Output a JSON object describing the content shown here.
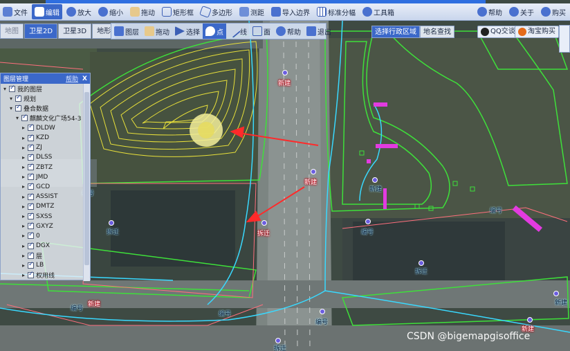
{
  "toolbar": {
    "file": "文件",
    "edit": "编辑",
    "zoom_in": "放大",
    "zoom_out": "缩小",
    "pan": "拖动",
    "rect": "矩形框",
    "polygon": "多边形",
    "measure": "测距",
    "import": "导入边界",
    "grid": "标准分幅",
    "toolbox": "工具箱",
    "help": "帮助",
    "about": "关于",
    "buy": "购买"
  },
  "view_tabs": {
    "map": "地图",
    "sat2d": "卫星2D",
    "sat3d": "卫星3D",
    "terrain": "地形"
  },
  "tools2": {
    "layers": "图层",
    "pan": "拖动",
    "select": "选择",
    "point": "点",
    "line": "线",
    "area": "面",
    "help": "帮助",
    "exit": "退出"
  },
  "region": {
    "select_region": "选择行政区域",
    "place_search": "地名查找"
  },
  "qq": "QQ交谈",
  "shop": "淘宝购买",
  "panel": {
    "title": "图层管理",
    "help": "帮助",
    "close": "X",
    "rows": [
      {
        "label": "我的图层",
        "indent": 0
      },
      {
        "label": "规划",
        "indent": 1
      },
      {
        "label": "叠合数据",
        "indent": 1
      },
      {
        "label": "麒麟文化广场54-3",
        "indent": 2
      },
      {
        "label": "DLDW",
        "indent": 3
      },
      {
        "label": "KZD",
        "indent": 3
      },
      {
        "label": "ZJ",
        "indent": 3
      },
      {
        "label": "DLSS",
        "indent": 3
      },
      {
        "label": "ZBTZ",
        "indent": 3
      },
      {
        "label": "JMD",
        "indent": 3
      },
      {
        "label": "GCD",
        "indent": 3
      },
      {
        "label": "ASSIST",
        "indent": 3
      },
      {
        "label": "DMTZ",
        "indent": 3
      },
      {
        "label": "SXSS",
        "indent": 3
      },
      {
        "label": "GXYZ",
        "indent": 3
      },
      {
        "label": "0",
        "indent": 3
      },
      {
        "label": "DGX",
        "indent": 3
      },
      {
        "label": "层",
        "indent": 3
      },
      {
        "label": "LB",
        "indent": 3
      },
      {
        "label": "权用线",
        "indent": 3
      }
    ]
  },
  "map_labels": {
    "l1": "新建",
    "l2": "新建",
    "l3": "拆迁",
    "l4": "编号",
    "l5": "拆迁",
    "l6": "新建",
    "l7": "编号",
    "l8": "编号",
    "l9": "拆迁",
    "l10": "编号",
    "l11": "编号",
    "l12": "新建",
    "l13": "编号",
    "l14": "拆迁",
    "l15": "新建",
    "l16": "新建"
  },
  "watermark": "CSDN @bigemapgisoffice"
}
